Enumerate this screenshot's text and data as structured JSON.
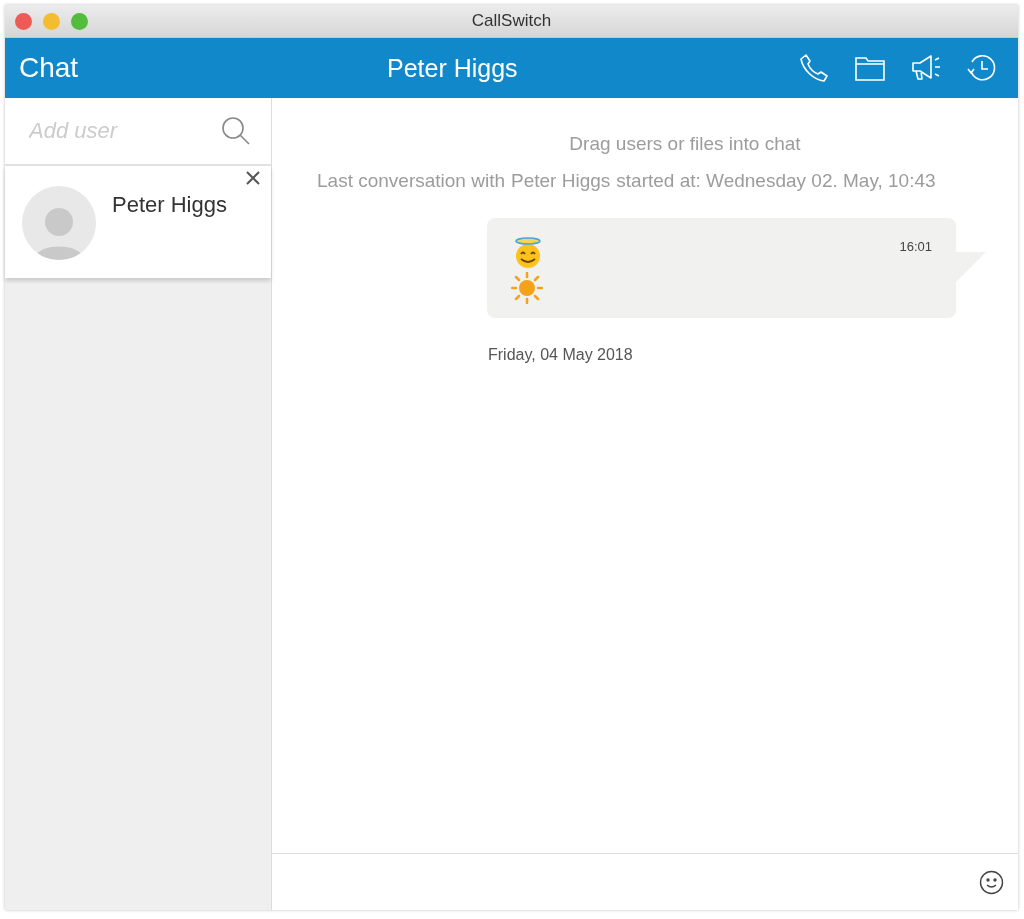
{
  "window": {
    "title": "CallSwitch"
  },
  "header": {
    "section": "Chat",
    "contact": "Peter Higgs"
  },
  "search": {
    "placeholder": "Add user"
  },
  "contacts": [
    {
      "name": "Peter Higgs"
    }
  ],
  "chat": {
    "hint": "Drag users or files into chat",
    "last_prefix": "Last conversation with",
    "last_name": "Peter Higgs",
    "last_suffix": "started at: Wednesday 02. May, 10:43",
    "messages": [
      {
        "time": "16:01"
      }
    ],
    "date_separator": "Friday, 04 May 2018"
  }
}
